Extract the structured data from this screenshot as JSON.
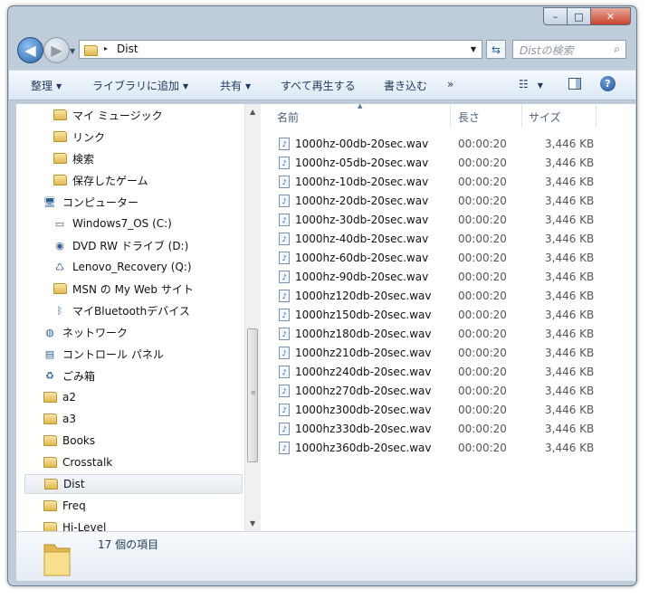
{
  "window": {
    "controls": {
      "minimize_glyph": "–",
      "maximize_glyph": "□",
      "close_glyph": "✕"
    }
  },
  "address_bar": {
    "crumb": "Dist",
    "separator": "▸",
    "search_placeholder": "Distの検索"
  },
  "toolbar": {
    "organize": "整理",
    "library": "ライブラリに追加",
    "share": "共有",
    "play_all": "すべて再生する",
    "burn": "書き込む",
    "more": "»"
  },
  "nav_tree": [
    {
      "label": "マイ ミュージック",
      "icon": "music-folder-icon",
      "indent": 2
    },
    {
      "label": "リンク",
      "icon": "links-folder-icon",
      "indent": 2
    },
    {
      "label": "検索",
      "icon": "search-folder-icon",
      "indent": 2
    },
    {
      "label": "保存したゲーム",
      "icon": "saved-games-icon",
      "indent": 2
    },
    {
      "label": "コンピューター",
      "icon": "computer-icon",
      "indent": 1
    },
    {
      "label": "Windows7_OS (C:)",
      "icon": "drive-icon",
      "indent": 2
    },
    {
      "label": "DVD RW ドライブ (D:)",
      "icon": "dvd-drive-icon",
      "indent": 2
    },
    {
      "label": "Lenovo_Recovery (Q:)",
      "icon": "recovery-drive-icon",
      "indent": 2
    },
    {
      "label": "MSN の My Web サイト",
      "icon": "msn-folder-icon",
      "indent": 2
    },
    {
      "label": "マイBluetoothデバイス",
      "icon": "bluetooth-icon",
      "indent": 2
    },
    {
      "label": "ネットワーク",
      "icon": "network-icon",
      "indent": 1
    },
    {
      "label": "コントロール パネル",
      "icon": "control-panel-icon",
      "indent": 1
    },
    {
      "label": "ごみ箱",
      "icon": "recycle-bin-icon",
      "indent": 1
    },
    {
      "label": "a2",
      "icon": "folder-icon",
      "indent": 1
    },
    {
      "label": "a3",
      "icon": "folder-icon",
      "indent": 1
    },
    {
      "label": "Books",
      "icon": "folder-icon",
      "indent": 1
    },
    {
      "label": "Crosstalk",
      "icon": "folder-icon",
      "indent": 1
    },
    {
      "label": "Dist",
      "icon": "folder-icon",
      "indent": 1,
      "selected": true
    },
    {
      "label": "Freq",
      "icon": "folder-icon",
      "indent": 1
    },
    {
      "label": "Hi-Level",
      "icon": "folder-icon",
      "indent": 1
    }
  ],
  "columns": {
    "name": "名前",
    "length": "長さ",
    "size": "サイズ"
  },
  "files": [
    {
      "name": "1000hz-00db-20sec.wav",
      "length": "00:00:20",
      "size": "3,446 KB"
    },
    {
      "name": "1000hz-05db-20sec.wav",
      "length": "00:00:20",
      "size": "3,446 KB"
    },
    {
      "name": "1000hz-10db-20sec.wav",
      "length": "00:00:20",
      "size": "3,446 KB"
    },
    {
      "name": "1000hz-20db-20sec.wav",
      "length": "00:00:20",
      "size": "3,446 KB"
    },
    {
      "name": "1000hz-30db-20sec.wav",
      "length": "00:00:20",
      "size": "3,446 KB"
    },
    {
      "name": "1000hz-40db-20sec.wav",
      "length": "00:00:20",
      "size": "3,446 KB"
    },
    {
      "name": "1000hz-60db-20sec.wav",
      "length": "00:00:20",
      "size": "3,446 KB"
    },
    {
      "name": "1000hz-90db-20sec.wav",
      "length": "00:00:20",
      "size": "3,446 KB"
    },
    {
      "name": "1000hz120db-20sec.wav",
      "length": "00:00:20",
      "size": "3,446 KB"
    },
    {
      "name": "1000hz150db-20sec.wav",
      "length": "00:00:20",
      "size": "3,446 KB"
    },
    {
      "name": "1000hz180db-20sec.wav",
      "length": "00:00:20",
      "size": "3,446 KB"
    },
    {
      "name": "1000hz210db-20sec.wav",
      "length": "00:00:20",
      "size": "3,446 KB"
    },
    {
      "name": "1000hz240db-20sec.wav",
      "length": "00:00:20",
      "size": "3,446 KB"
    },
    {
      "name": "1000hz270db-20sec.wav",
      "length": "00:00:20",
      "size": "3,446 KB"
    },
    {
      "name": "1000hz300db-20sec.wav",
      "length": "00:00:20",
      "size": "3,446 KB"
    },
    {
      "name": "1000hz330db-20sec.wav",
      "length": "00:00:20",
      "size": "3,446 KB"
    },
    {
      "name": "1000hz360db-20sec.wav",
      "length": "00:00:20",
      "size": "3,446 KB"
    }
  ],
  "status": {
    "count_text": "17 個の項目"
  }
}
